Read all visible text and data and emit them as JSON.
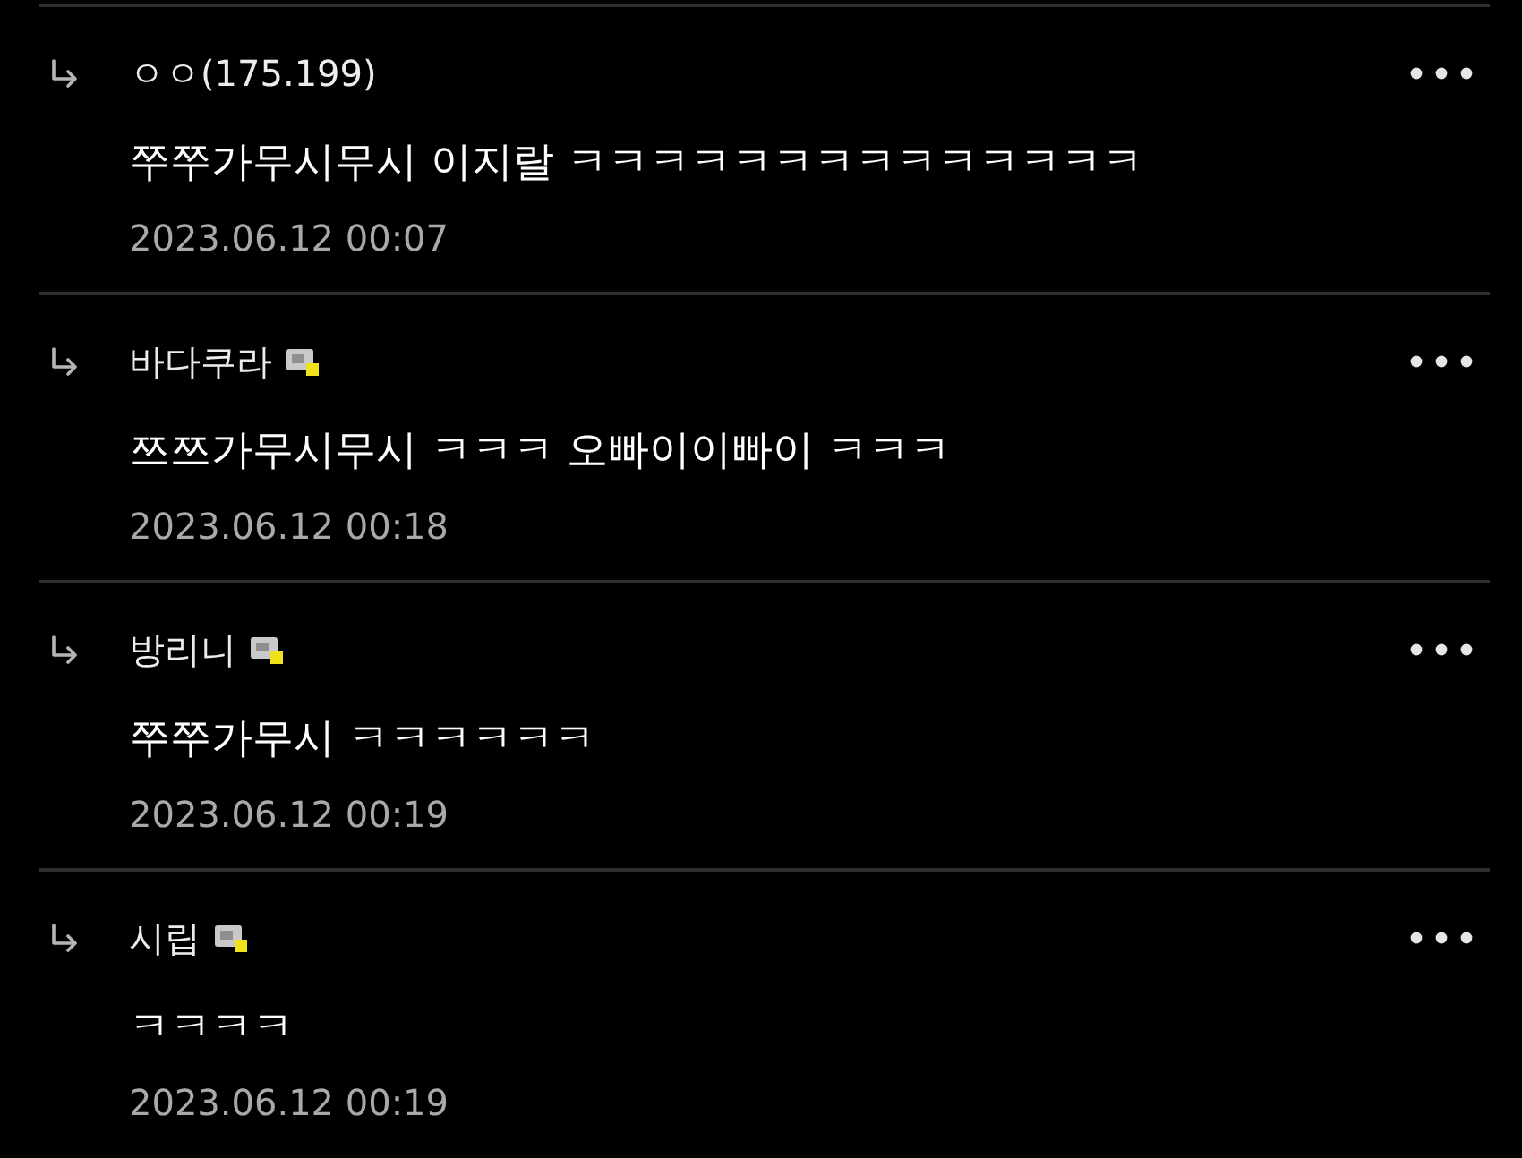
{
  "comments": [
    {
      "author": "ㅇㅇ(175.199)",
      "badge": false,
      "text": "쭈쭈가무시무시 이지랄 ㅋㅋㅋㅋㅋㅋㅋㅋㅋㅋㅋㅋㅋㅋ",
      "date": "2023.06.12 00:07"
    },
    {
      "author": "바다쿠라",
      "badge": true,
      "text": "쯔쯔가무시무시 ㅋㅋㅋ 오빠이이빠이 ㅋㅋㅋ",
      "date": "2023.06.12 00:18"
    },
    {
      "author": "방리니",
      "badge": true,
      "text": "쭈쭈가무시 ㅋㅋㅋㅋㅋㅋ",
      "date": "2023.06.12 00:19"
    },
    {
      "author": "시립",
      "badge": true,
      "text": "ㅋㅋㅋㅋ",
      "date": "2023.06.12 00:19"
    }
  ]
}
